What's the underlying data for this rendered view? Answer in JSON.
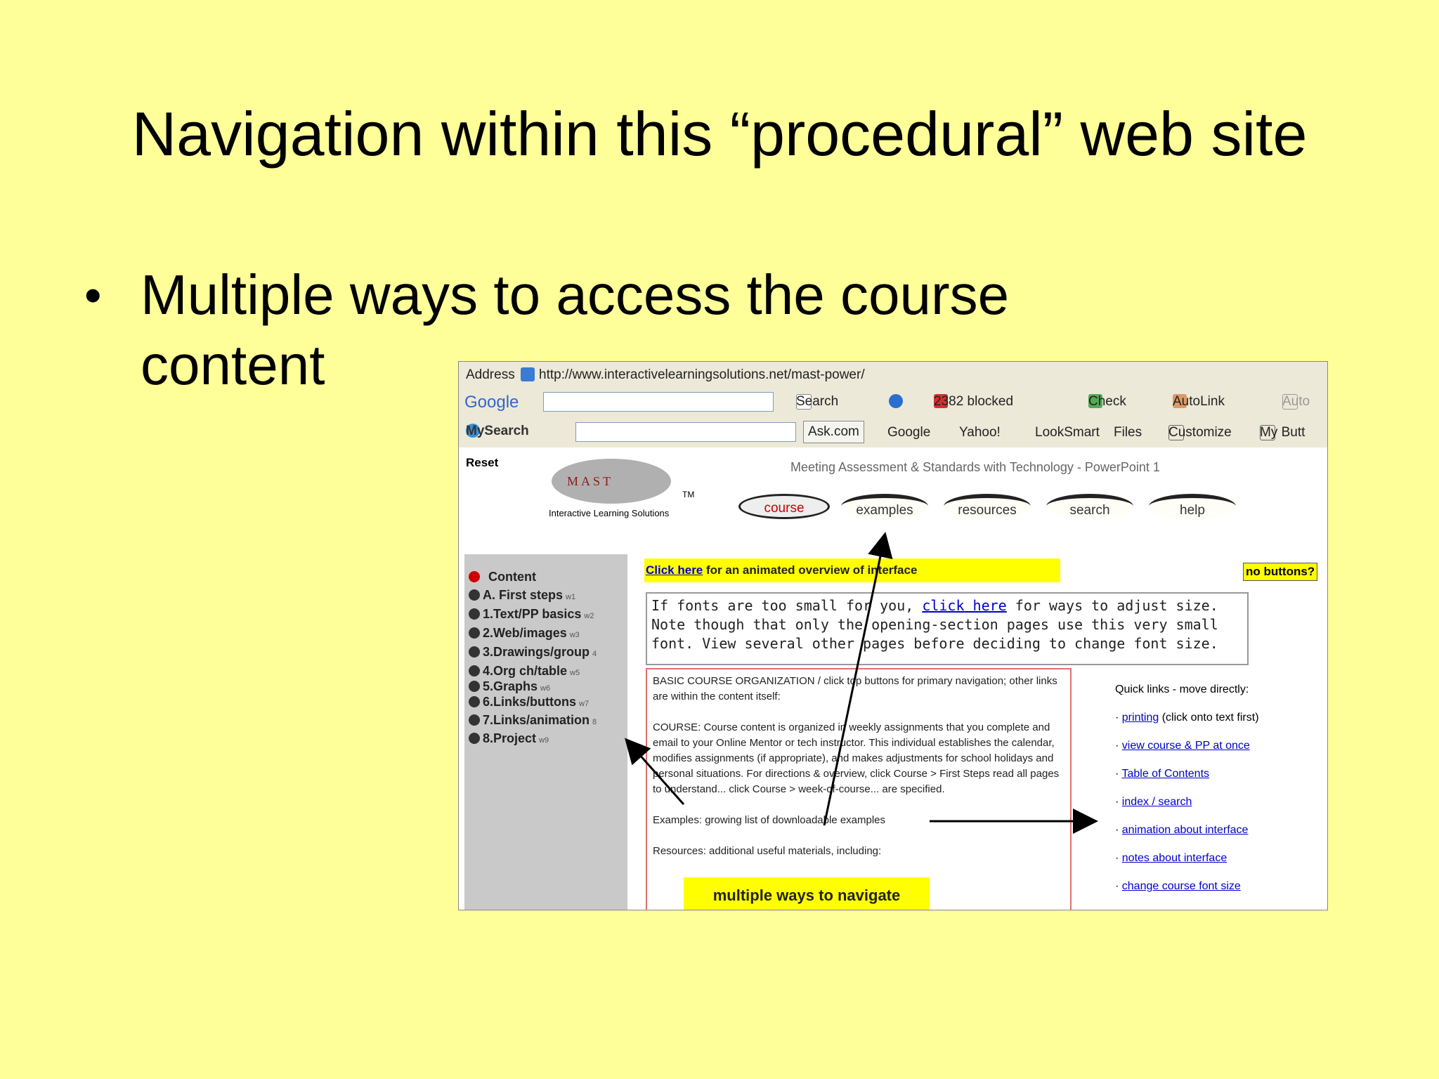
{
  "slide": {
    "title": "Navigation within this “procedural” web site",
    "bullet_marker": "•",
    "bullet_text": "Multiple ways to access the course content"
  },
  "browser": {
    "address_label": "Address",
    "url": "http://www.interactivelearningsolutions.net/mast-power/",
    "google_toolbar": {
      "logo": "Google",
      "search": "Search",
      "blocked": "2382 blocked",
      "check": "Check",
      "autolink": "AutoLink",
      "autofill": "Auto"
    },
    "mysearch_toolbar": {
      "logo": "MySearch",
      "ask": "Ask.com",
      "google": "Google",
      "yahoo": "Yahoo!",
      "looksmart": "LookSmart",
      "files": "Files",
      "customize": "Customize",
      "mybutton": "My Butt"
    }
  },
  "site": {
    "reset": "Reset",
    "logo_text": "MAST",
    "logo_tm": "TM",
    "logo_sub": "Interactive Learning Solutions",
    "header": "Meeting Assessment & Standards with Technology - PowerPoint 1",
    "tabs": [
      "course",
      "examples",
      "resources",
      "search",
      "help"
    ],
    "banner_link": "Click here",
    "banner_rest": " for an animated overview of interface",
    "no_buttons": "no buttons?",
    "font_notice_pre": "If fonts are too small for you, ",
    "font_notice_link": "click here",
    "font_notice_post": " for ways to adjust size. Note though that only the opening-section pages use this very small font. View several other pages before deciding to change font size.",
    "left_nav": [
      {
        "label": "Content",
        "week": "",
        "active": true
      },
      {
        "label": "A. First steps",
        "week": "w1"
      },
      {
        "label": "1.Text/PP basics",
        "week": "w2"
      },
      {
        "label": "2.Web/images",
        "week": "w3"
      },
      {
        "label": "3.Drawings/group",
        "week": "4"
      },
      {
        "label": "4.Org ch/table",
        "week": "w5"
      },
      {
        "label": "5.Graphs",
        "week": "w6"
      },
      {
        "label": "6.Links/buttons",
        "week": "w7"
      },
      {
        "label": "7.Links/animation",
        "week": "8"
      },
      {
        "label": "8.Project",
        "week": "w9"
      }
    ],
    "course_text": {
      "p1": "BASIC COURSE ORGANIZATION / click top buttons for primary navigation; other links are within the content itself:",
      "p2": "COURSE: Course content is organized in weekly assignments that you complete and email to your Online Mentor or tech instructor. This individual establishes the calendar, modifies assignments (if appropriate), and makes adjustments for school holidays and personal situations. For directions & overview, click Course > First Steps read all pages to understand... click Course > week-of-course... are specified.",
      "p3": "Examples: growing list of downloadable examples",
      "p4": "Resources: additional useful materials, including:"
    },
    "quick_links_title": "Quick links - move directly:",
    "quick_links": [
      {
        "link": "printing",
        "note": " (click onto text first)"
      },
      {
        "link": "view course & PP at once",
        "note": ""
      },
      {
        "link": "Table of Contents",
        "note": ""
      },
      {
        "link": "index / search",
        "note": ""
      },
      {
        "link": "animation about interface",
        "note": ""
      },
      {
        "link": "notes about interface",
        "note": ""
      },
      {
        "link": "change course font size",
        "note": ""
      }
    ],
    "callout": "multiple ways to navigate"
  },
  "colors": {
    "slide_bg": "#ffff99",
    "highlight": "#ffff00",
    "link": "#0000cc",
    "active_red": "#cc0000"
  }
}
